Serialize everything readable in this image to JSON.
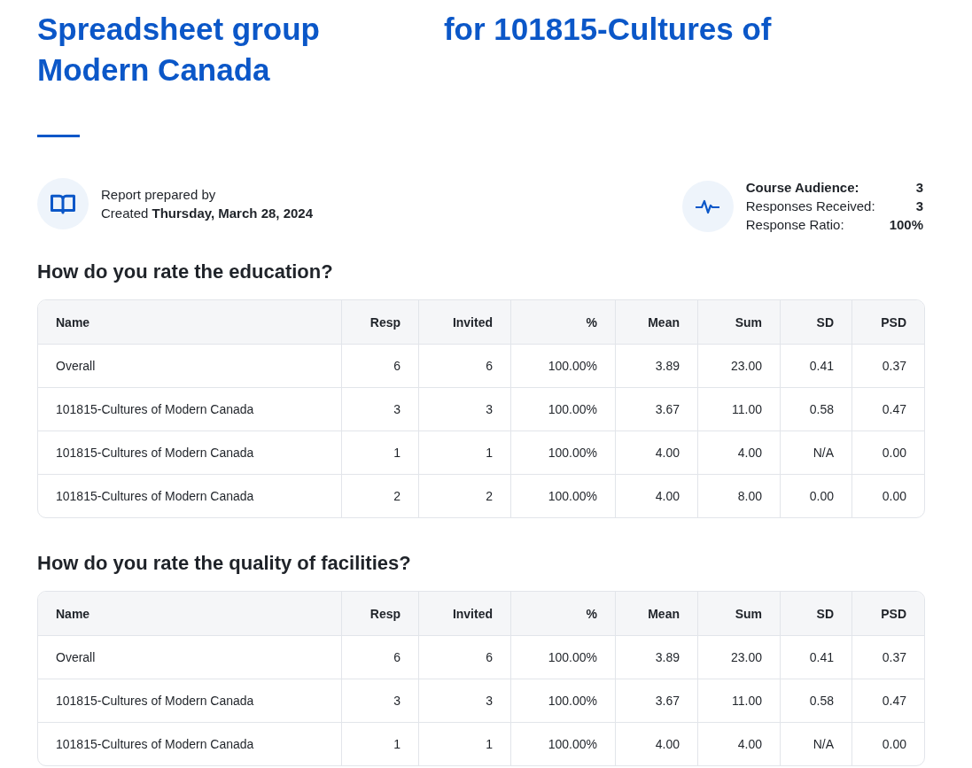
{
  "title": {
    "first": "Spreadsheet group",
    "rest": "for 101815-Cultures of Modern Canada"
  },
  "report": {
    "prepared": "Report prepared by",
    "created_label": "Created",
    "created_date": "Thursday, March 28, 2024"
  },
  "stats": [
    {
      "label": "Course Audience:",
      "value": "3",
      "bold": true
    },
    {
      "label": "Responses Received:",
      "value": "3",
      "bold": false
    },
    {
      "label": "Response Ratio:",
      "value": "100%",
      "bold": false
    }
  ],
  "sections": [
    {
      "question": "How do you rate the education?",
      "columns": [
        "Name",
        "Resp",
        "Invited",
        "%",
        "Mean",
        "Sum",
        "SD",
        "PSD"
      ],
      "rows": [
        [
          "Overall",
          "6",
          "6",
          "100.00%",
          "3.89",
          "23.00",
          "0.41",
          "0.37"
        ],
        [
          "101815-Cultures of Modern Canada",
          "3",
          "3",
          "100.00%",
          "3.67",
          "11.00",
          "0.58",
          "0.47"
        ],
        [
          "101815-Cultures of Modern Canada",
          "1",
          "1",
          "100.00%",
          "4.00",
          "4.00",
          "N/A",
          "0.00"
        ],
        [
          "101815-Cultures of Modern Canada",
          "2",
          "2",
          "100.00%",
          "4.00",
          "8.00",
          "0.00",
          "0.00"
        ]
      ]
    },
    {
      "question": "How do you rate the quality of facilities?",
      "columns": [
        "Name",
        "Resp",
        "Invited",
        "%",
        "Mean",
        "Sum",
        "SD",
        "PSD"
      ],
      "rows": [
        [
          "Overall",
          "6",
          "6",
          "100.00%",
          "3.89",
          "23.00",
          "0.41",
          "0.37"
        ],
        [
          "101815-Cultures of Modern Canada",
          "3",
          "3",
          "100.00%",
          "3.67",
          "11.00",
          "0.58",
          "0.47"
        ],
        [
          "101815-Cultures of Modern Canada",
          "1",
          "1",
          "100.00%",
          "4.00",
          "4.00",
          "N/A",
          "0.00"
        ]
      ]
    }
  ]
}
